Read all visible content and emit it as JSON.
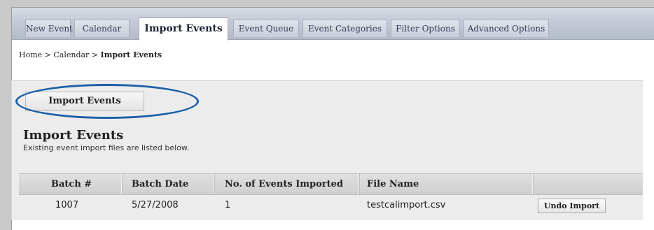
{
  "tabs": [
    {
      "label": "New Event"
    },
    {
      "label": "Calendar"
    },
    {
      "label": "Import Events"
    },
    {
      "label": "Event Queue"
    },
    {
      "label": "Event Categories"
    },
    {
      "label": "Filter Options"
    },
    {
      "label": "Advanced Options"
    }
  ],
  "active_tab": "Import Events",
  "breadcrumb": {
    "home": "Home",
    "sep1": " > ",
    "calendar": "Calendar",
    "sep2": " > ",
    "current": "Import Events"
  },
  "import_button": {
    "label": "Import Events"
  },
  "section": {
    "title": "Import Events",
    "description": "Existing event import files are listed below."
  },
  "table": {
    "columns": [
      "Batch #",
      "Batch Date",
      "No. of Events Imported",
      "File Name",
      ""
    ],
    "rows": [
      {
        "batch": "1007",
        "date": "5/27/2008",
        "count": "1",
        "file": "testcalimport.csv",
        "action": "Undo Import"
      }
    ]
  },
  "colors": {
    "highlight_oval": "#1b5fa8",
    "tabbar": "#c4cad6",
    "background": "#c9c9c9"
  }
}
